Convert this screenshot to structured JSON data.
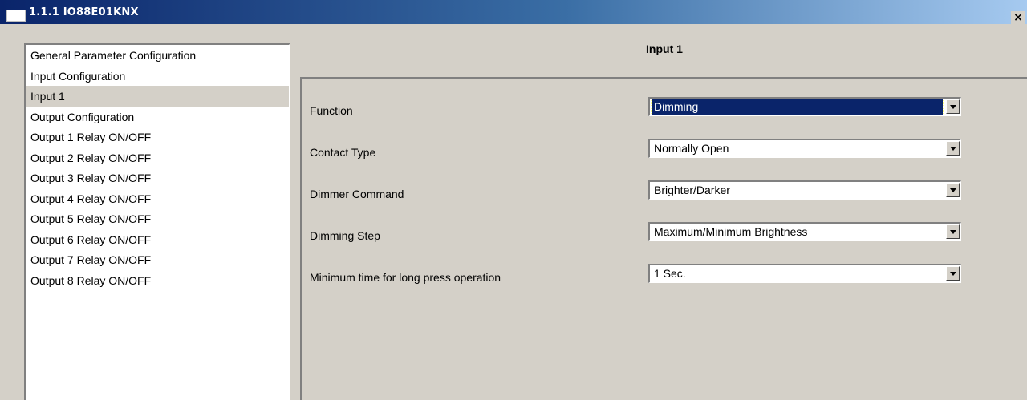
{
  "window": {
    "title": "1.1.1 IO88E01KNX",
    "close_label": "×"
  },
  "sidebar": {
    "items": [
      {
        "label": "General Parameter Configuration"
      },
      {
        "label": "Input Configuration"
      },
      {
        "label": "Input 1",
        "selected": true
      },
      {
        "label": "Output Configuration"
      },
      {
        "label": "Output 1 Relay ON/OFF"
      },
      {
        "label": "Output 2 Relay ON/OFF"
      },
      {
        "label": "Output 3 Relay ON/OFF"
      },
      {
        "label": "Output 4 Relay ON/OFF"
      },
      {
        "label": "Output 5 Relay ON/OFF"
      },
      {
        "label": "Output 6 Relay ON/OFF"
      },
      {
        "label": "Output 7 Relay ON/OFF"
      },
      {
        "label": "Output 8 Relay ON/OFF"
      }
    ]
  },
  "main": {
    "title": "Input 1",
    "params": [
      {
        "label": "Function",
        "value": "Dimming",
        "icon": "chevron-down-icon"
      },
      {
        "label": "Contact Type",
        "value": "Normally Open",
        "icon": "chevron-down-icon"
      },
      {
        "label": "Dimmer Command",
        "value": "Brighter/Darker",
        "icon": "chevron-down-icon"
      },
      {
        "label": "Dimming Step",
        "value": "Maximum/Minimum Brightness",
        "icon": "chevron-down-icon"
      },
      {
        "label": "Minimum time for long press operation",
        "value": "1 Sec.",
        "icon": "chevron-down-icon"
      }
    ]
  },
  "colors": {
    "titlebar_start": "#0a246a",
    "titlebar_end": "#a6caf0",
    "selection": "#0a246a",
    "face": "#d4d0c8"
  }
}
